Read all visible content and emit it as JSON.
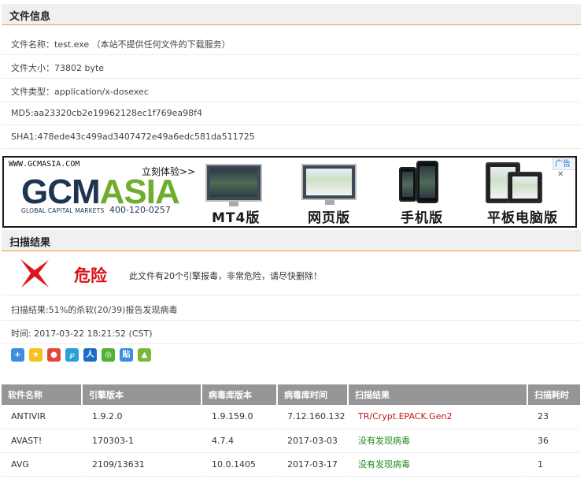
{
  "file_info": {
    "heading": "文件信息",
    "name_label": "文件名称：",
    "name_value": "test.exe",
    "name_note": "（本站不提供任何文件的下载服务）",
    "size_label": "文件大小：",
    "size_value": "73802 byte",
    "type_label": "文件类型：",
    "type_value": "application/x-dosexec",
    "md5_label": "MD5:",
    "md5_value": "aa23320cb2e19962128ec1f769ea98f4",
    "sha1_label": "SHA1:",
    "sha1_value": "478ede43c499ad3407472e49a6edc581da511725"
  },
  "ad": {
    "url": "WWW.GCMASIA.COM",
    "cta": "立刻体验>>",
    "logo_part1": "GCM",
    "logo_part2": "ASIA",
    "subtitle": "GLOBAL CAPITAL MARKETS",
    "phone": "400-120-0257",
    "tag": "广告",
    "close": "✕",
    "products": [
      "MT4版",
      "网页版",
      "手机版",
      "平板电脑版"
    ]
  },
  "scan": {
    "heading": "扫描结果",
    "level": "危险",
    "message": "此文件有20个引擎报毒，非常危险，请尽快删除！",
    "summary": "扫描结果:51%的杀软(20/39)报告发现病毒",
    "time": "时间: 2017-03-22 18:21:52 (CST)"
  },
  "share_icons": [
    "plus-share-icon",
    "qzone-icon",
    "weibo-icon",
    "tencent-weibo-icon",
    "renren-icon",
    "wechat-icon",
    "tieba-icon",
    "pengyou-icon"
  ],
  "table": {
    "headers": [
      "软件名称",
      "引擎版本",
      "病毒库版本",
      "病毒库时间",
      "扫描结果",
      "扫描耗时"
    ],
    "rows": [
      [
        "ANTIVIR",
        "1.9.2.0",
        "1.9.159.0",
        "7.12.160.132",
        "TR/Crypt.EPACK.Gen2",
        "23"
      ],
      [
        "AVAST!",
        "170303-1",
        "4.7.4",
        "2017-03-03",
        "没有发现病毒",
        "36"
      ],
      [
        "AVG",
        "2109/13631",
        "10.0.1405",
        "2017-03-17",
        "没有发现病毒",
        "1"
      ]
    ]
  },
  "colors": {
    "accent_orange": "#f19d2a",
    "danger_red": "#d9121a",
    "ok_green": "#1f8a1f",
    "header_gray": "#969696"
  }
}
